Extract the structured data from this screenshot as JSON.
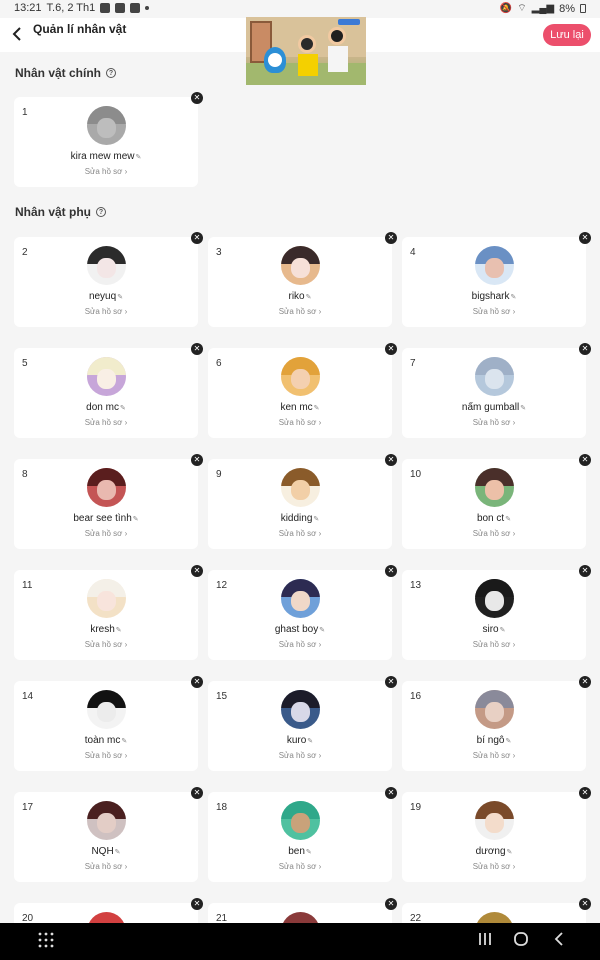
{
  "status_bar": {
    "time": "13:21",
    "date": "T.6, 2 Th1",
    "battery": "8%"
  },
  "header": {
    "title": "Quản lí nhân vật",
    "save_label": "Lưu lại"
  },
  "main_section": {
    "title": "Nhân vật chính"
  },
  "side_section": {
    "title": "Nhân vật phụ"
  },
  "edit_label": "Sửa hồ sơ",
  "characters": [
    {
      "num": "1",
      "name": "kira mew mew",
      "hair": "#8c8c8c",
      "face": "#bdbdbd",
      "bg": "#a9a9a9"
    },
    {
      "num": "2",
      "name": "neyuq",
      "hair": "#2b2b2b",
      "face": "#f3e6e6",
      "bg": "#f1f1f1"
    },
    {
      "num": "3",
      "name": "riko",
      "hair": "#3a2a2a",
      "face": "#f6e0d8",
      "bg": "#e7b98d"
    },
    {
      "num": "4",
      "name": "bigshark",
      "hair": "#6a90c4",
      "face": "#e8c0b0",
      "bg": "#d9e7f5"
    },
    {
      "num": "5",
      "name": "don mc",
      "hair": "#f1eccc",
      "face": "#f9efe5",
      "bg": "#c7a6d9"
    },
    {
      "num": "6",
      "name": "ken mc",
      "hair": "#e2a23a",
      "face": "#f4d0b0",
      "bg": "#f1c070"
    },
    {
      "num": "7",
      "name": "nấm gumball",
      "hair": "#9fb0c7",
      "face": "#dbe4ee",
      "bg": "#b5c8dc"
    },
    {
      "num": "8",
      "name": "bear see tình",
      "hair": "#5a1e1e",
      "face": "#e9b9b0",
      "bg": "#c45555"
    },
    {
      "num": "9",
      "name": "kidding",
      "hair": "#8a5b2a",
      "face": "#f2cfa7",
      "bg": "#f7efe0"
    },
    {
      "num": "10",
      "name": "bon ct",
      "hair": "#4a2f2a",
      "face": "#ecc0a8",
      "bg": "#7ab57a"
    },
    {
      "num": "11",
      "name": "kresh",
      "hair": "#f4f0e8",
      "face": "#f8e4dc",
      "bg": "#f3e1c6"
    },
    {
      "num": "12",
      "name": "ghast boy",
      "hair": "#2d2b52",
      "face": "#f0d8c8",
      "bg": "#6fa0d9"
    },
    {
      "num": "13",
      "name": "siro",
      "hair": "#1a1a1a",
      "face": "#e8e8e8",
      "bg": "#202020"
    },
    {
      "num": "14",
      "name": "toàn mc",
      "hair": "#121212",
      "face": "#ececec",
      "bg": "#f3f3f3"
    },
    {
      "num": "15",
      "name": "kuro",
      "hair": "#1c1c2a",
      "face": "#d8d8e8",
      "bg": "#3a5a8a"
    },
    {
      "num": "16",
      "name": "bí ngô",
      "hair": "#8a8a9a",
      "face": "#e8d0c4",
      "bg": "#c49a86"
    },
    {
      "num": "17",
      "name": "NQH",
      "hair": "#4a2020",
      "face": "#e3cdc6",
      "bg": "#cfc1c1"
    },
    {
      "num": "18",
      "name": "ben",
      "hair": "#2fa88a",
      "face": "#c9a27a",
      "bg": "#4fc1a0"
    },
    {
      "num": "19",
      "name": "dương",
      "hair": "#7a4a2a",
      "face": "#f3dccb",
      "bg": "#f0f0f0"
    },
    {
      "num": "20",
      "name": "",
      "hair": "#d24040",
      "face": "#f3e4e4",
      "bg": "#f8f8f8"
    },
    {
      "num": "21",
      "name": "",
      "hair": "#8a3a3a",
      "face": "#efd6c6",
      "bg": "#f8f8f8"
    },
    {
      "num": "22",
      "name": "",
      "hair": "#b08a3a",
      "face": "#f3e0c4",
      "bg": "#f8f8f8"
    }
  ]
}
